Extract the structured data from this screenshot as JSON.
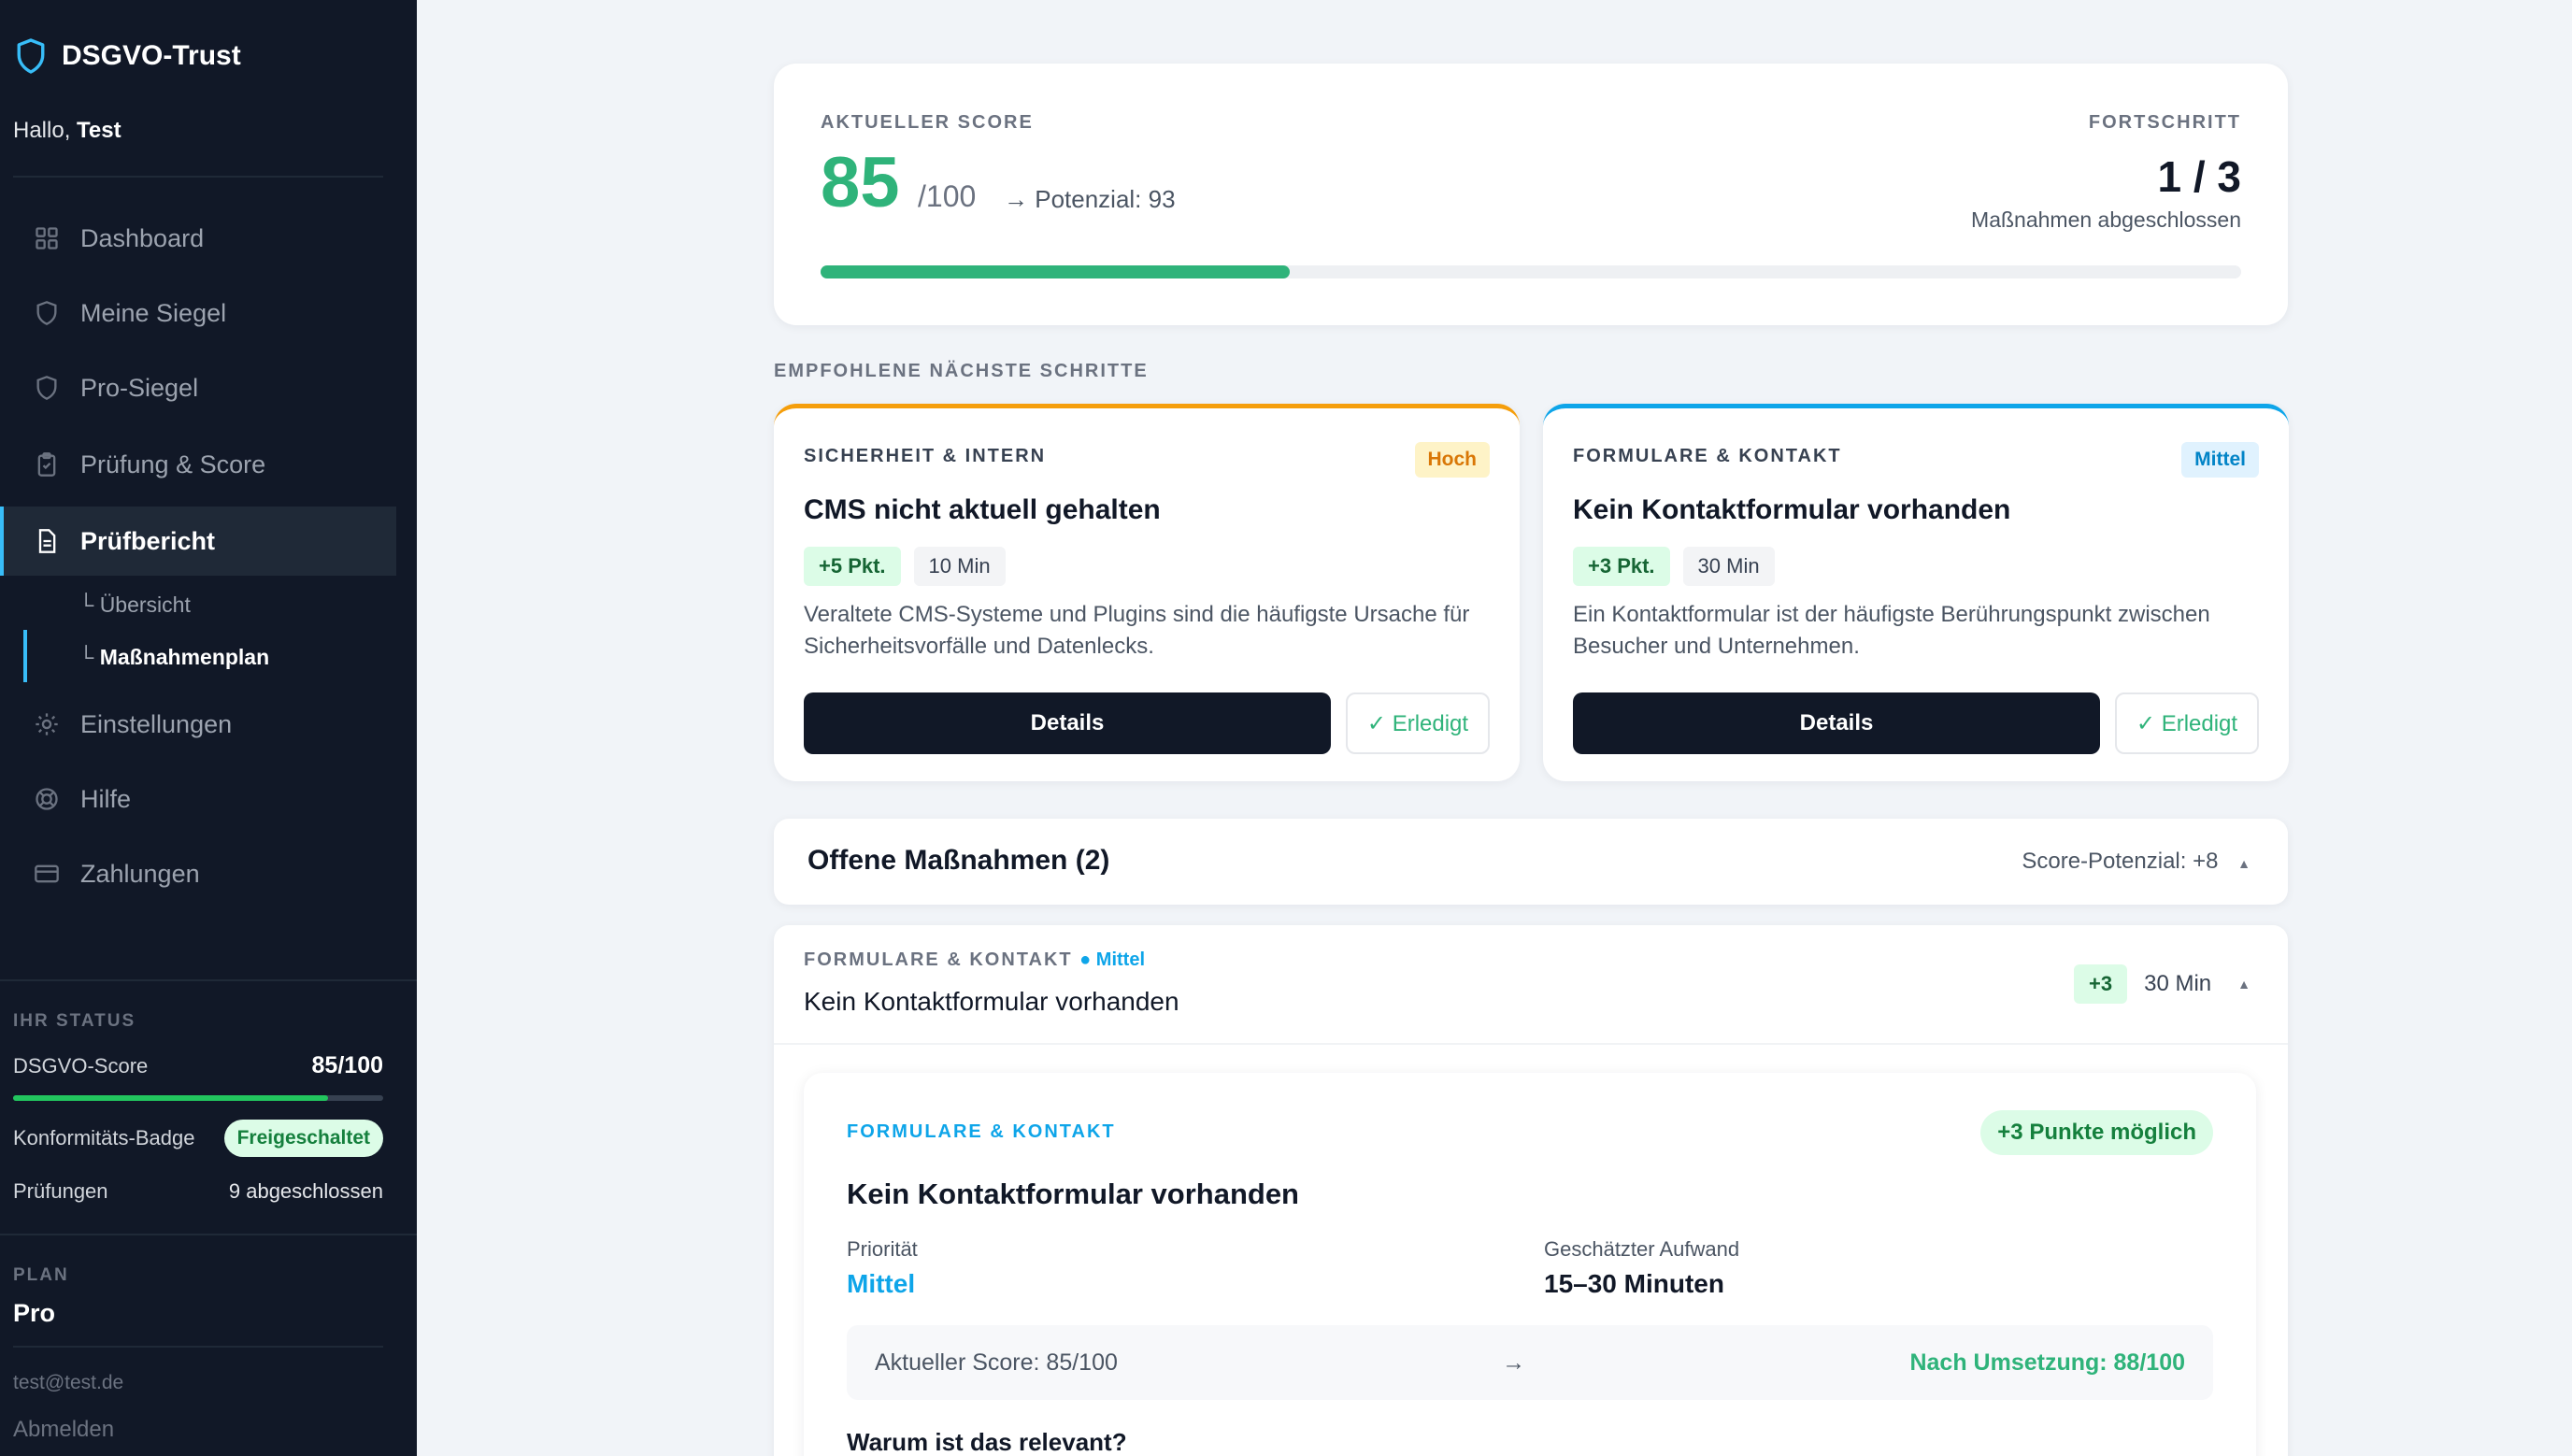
{
  "sidebar": {
    "brand": "DSGVO-Trust",
    "greeting": "Hallo,",
    "user": "Test",
    "nav": [
      {
        "label": "Dashboard",
        "icon": "grid-icon"
      },
      {
        "label": "Meine Siegel",
        "icon": "shield-icon"
      },
      {
        "label": "Pro-Siegel",
        "icon": "shield-icon"
      },
      {
        "label": "Prüfung & Score",
        "icon": "clipboard-check-icon"
      },
      {
        "label": "Prüfbericht",
        "icon": "document-icon",
        "active": true
      },
      {
        "label": "Einstellungen",
        "icon": "gear-icon"
      },
      {
        "label": "Hilfe",
        "icon": "lifebuoy-icon"
      },
      {
        "label": "Zahlungen",
        "icon": "credit-card-icon"
      }
    ],
    "subnav": [
      "Übersicht",
      "Maßnahmenplan"
    ],
    "status": {
      "label": "IHR STATUS",
      "score_label": "DSGVO-Score",
      "score_value": "85/100",
      "score_fraction": 0.85,
      "badge_label": "Konformitäts-Badge",
      "badge_value": "Freigeschaltet",
      "checks_label": "Prüfungen",
      "checks_value": "9 abgeschlossen"
    },
    "plan_label": "PLAN",
    "plan_value": "Pro",
    "email": "test@test.de",
    "logout": "Abmelden"
  },
  "score": {
    "label": "AKTUELLER SCORE",
    "value": "85",
    "max": "/100",
    "potential": "→ Potenzial: 93",
    "progress_label": "FORTSCHRITT",
    "progress_value": "1 / 3",
    "progress_sub": "Maßnahmen abgeschlossen",
    "progress_fraction": 0.33
  },
  "recommended": {
    "label": "EMPFOHLENE NÄCHSTE SCHRITTE",
    "cards": [
      {
        "category": "SICHERHEIT & INTERN",
        "priority": "Hoch",
        "title": "CMS nicht aktuell gehalten",
        "points": "+5 Pkt.",
        "time": "10 Min",
        "desc": "Veraltete CMS-Systeme und Plugins sind die häufigste Ursache für Sicherheitsvorfälle und Datenlecks.",
        "details": "Details",
        "done": "✓ Erledigt",
        "accent": "#f59e0b"
      },
      {
        "category": "FORMULARE & KONTAKT",
        "priority": "Mittel",
        "title": "Kein Kontaktformular vorhanden",
        "points": "+3 Pkt.",
        "time": "30 Min",
        "desc": "Ein Kontaktformular ist der häufigste Berührungspunkt zwischen Besucher und Unternehmen.",
        "details": "Details",
        "done": "✓ Erledigt",
        "accent": "#0ea5e9"
      }
    ]
  },
  "open": {
    "title": "Offene Maßnahmen (2)",
    "potential": "Score-Potenzial: +8"
  },
  "item": {
    "category": "FORMULARE & KONTAKT",
    "priority": "● Mittel",
    "title": "Kein Kontaktformular vorhanden",
    "points": "+3",
    "time": "30 Min",
    "detail": {
      "category": "FORMULARE & KONTAKT",
      "points": "+3 Punkte möglich",
      "title": "Kein Kontaktformular vorhanden",
      "prio_label": "Priorität",
      "prio_value": "Mittel",
      "effort_label": "Geschätzter Aufwand",
      "effort_value": "15–30 Minuten",
      "current": "Aktueller Score: 85/100",
      "arrow": "→",
      "after": "Nach Umsetzung: 88/100",
      "why": "Warum ist das relevant?"
    }
  }
}
